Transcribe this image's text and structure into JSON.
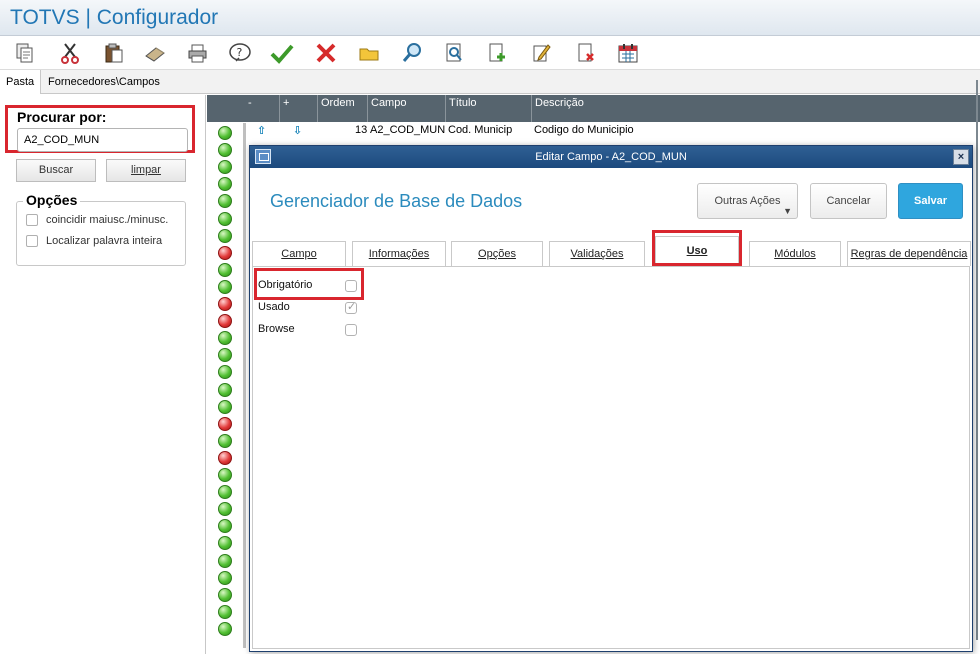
{
  "window": {
    "title": "TOTVS | Configurador"
  },
  "toolbar": {
    "icons": [
      "copy-icon",
      "cut-icon",
      "paste-icon",
      "eraser-icon",
      "print-icon",
      "help-icon",
      "confirm-icon",
      "cancel-icon",
      "folder-icon",
      "search-icon",
      "preview-icon",
      "add-document-icon",
      "edit-document-icon",
      "delete-document-icon",
      "calendar-icon"
    ]
  },
  "folder_tabs": {
    "pasta": "Pasta",
    "path": "Fornecedores\\Campos"
  },
  "search": {
    "label": "Procurar por:",
    "value": "A2_COD_MUN",
    "buscar_label": "Buscar",
    "limpar_label": "limpar"
  },
  "options": {
    "title": "Opções",
    "items": [
      {
        "label": "coincidir maiusc./minusc.",
        "checked": false
      },
      {
        "label": "Localizar palavra inteira",
        "checked": false
      }
    ]
  },
  "grid": {
    "headers": [
      "-",
      "+",
      "Ordem",
      "Campo",
      "Título",
      "Descrição"
    ],
    "row": {
      "ordem": "13",
      "campo": "A2_COD_MUN",
      "titulo": "Cod. Municip",
      "descricao": "Codigo do Municipio"
    },
    "status_dots": [
      "green",
      "green",
      "green",
      "green",
      "green",
      "green",
      "green",
      "red",
      "green",
      "green",
      "red",
      "red",
      "green",
      "green",
      "green",
      "green",
      "green",
      "red",
      "green",
      "red",
      "green",
      "green",
      "green",
      "green",
      "green",
      "green",
      "green",
      "green",
      "green",
      "green"
    ]
  },
  "modal": {
    "title": "Editar Campo - A2_COD_MUN",
    "heading": "Gerenciador de Base de Dados",
    "outras_label": "Outras Ações",
    "cancelar_label": "Cancelar",
    "salvar_label": "Salvar",
    "close_label": "×",
    "tabs": [
      "Campo",
      "Informações",
      "Opções",
      "Validações",
      "Uso",
      "Módulos",
      "Regras de dependência"
    ],
    "active_tab": "Uso",
    "fields": [
      {
        "label": "Obrigatório",
        "checked": false
      },
      {
        "label": "Usado",
        "checked": true
      },
      {
        "label": "Browse",
        "checked": false
      }
    ]
  },
  "colors": {
    "accent": "#2277b5",
    "highlight": "#d9262e",
    "modal_bar": "#1c4a7e",
    "save": "#2fa6de"
  }
}
